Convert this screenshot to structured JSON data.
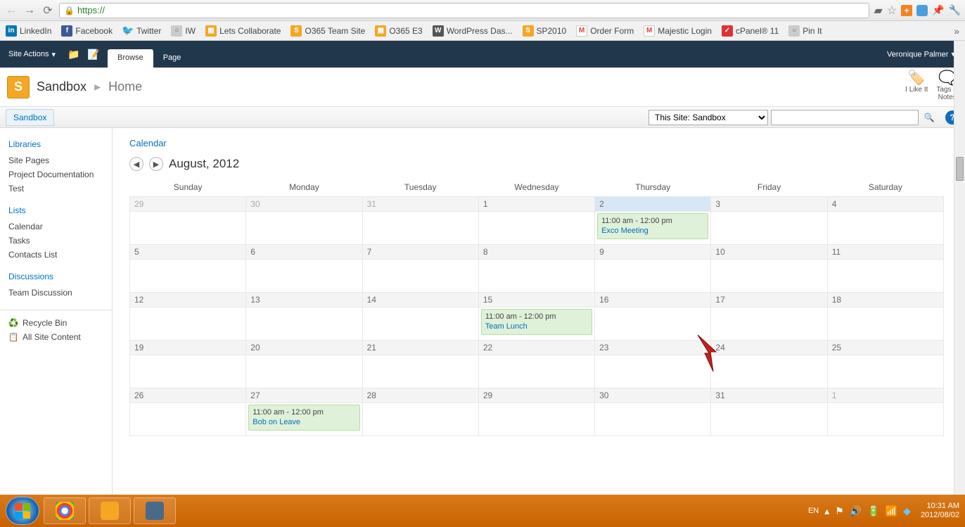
{
  "browser": {
    "url_scheme": "https://",
    "bookmarks": [
      {
        "label": "LinkedIn",
        "icon": "in"
      },
      {
        "label": "Facebook",
        "icon": "fb"
      },
      {
        "label": "Twitter",
        "icon": "tw"
      },
      {
        "label": "IW",
        "icon": "gray"
      },
      {
        "label": "Lets Collaborate",
        "icon": "or"
      },
      {
        "label": "O365 Team Site",
        "icon": "s"
      },
      {
        "label": "O365 E3",
        "icon": "or"
      },
      {
        "label": "WordPress Das...",
        "icon": "wp"
      },
      {
        "label": "SP2010",
        "icon": "s"
      },
      {
        "label": "Order Form",
        "icon": "g"
      },
      {
        "label": "Majestic Login",
        "icon": "g"
      },
      {
        "label": "cPanel® 11",
        "icon": "red"
      },
      {
        "label": "Pin It",
        "icon": "pin"
      }
    ]
  },
  "ribbon": {
    "site_actions": "Site Actions",
    "tabs": [
      {
        "label": "Browse",
        "active": true
      },
      {
        "label": "Page",
        "active": false
      }
    ],
    "user": "Veronique Palmer"
  },
  "title": {
    "site": "Sandbox",
    "page": "Home",
    "like_label": "I Like It",
    "tags_label": "Tags &\nNotes"
  },
  "topnav": {
    "tab": "Sandbox",
    "scope": "This Site: Sandbox"
  },
  "leftnav": {
    "groups": [
      {
        "heading": "Libraries",
        "items": [
          "Site Pages",
          "Project Documentation",
          "Test"
        ]
      },
      {
        "heading": "Lists",
        "items": [
          "Calendar",
          "Tasks",
          "Contacts List"
        ]
      },
      {
        "heading": "Discussions",
        "items": [
          "Team Discussion"
        ]
      }
    ],
    "util": [
      {
        "label": "Recycle Bin",
        "icon": "recycle"
      },
      {
        "label": "All Site Content",
        "icon": "allsite"
      }
    ]
  },
  "calendar": {
    "title": "Calendar",
    "month": "August, 2012",
    "days": [
      "Sunday",
      "Monday",
      "Tuesday",
      "Wednesday",
      "Thursday",
      "Friday",
      "Saturday"
    ],
    "weeks": [
      [
        {
          "n": "29",
          "other": true
        },
        {
          "n": "30",
          "other": true
        },
        {
          "n": "31",
          "other": true
        },
        {
          "n": "1"
        },
        {
          "n": "2",
          "today": true,
          "event": {
            "time": "11:00 am - 12:00 pm",
            "title": "Exco Meeting"
          }
        },
        {
          "n": "3"
        },
        {
          "n": "4"
        }
      ],
      [
        {
          "n": "5"
        },
        {
          "n": "6"
        },
        {
          "n": "7"
        },
        {
          "n": "8"
        },
        {
          "n": "9"
        },
        {
          "n": "10"
        },
        {
          "n": "11"
        }
      ],
      [
        {
          "n": "12"
        },
        {
          "n": "13"
        },
        {
          "n": "14"
        },
        {
          "n": "15",
          "event": {
            "time": "11:00 am - 12:00 pm",
            "title": "Team Lunch"
          }
        },
        {
          "n": "16"
        },
        {
          "n": "17"
        },
        {
          "n": "18"
        }
      ],
      [
        {
          "n": "19"
        },
        {
          "n": "20"
        },
        {
          "n": "21"
        },
        {
          "n": "22"
        },
        {
          "n": "23"
        },
        {
          "n": "24"
        },
        {
          "n": "25"
        }
      ],
      [
        {
          "n": "26"
        },
        {
          "n": "27",
          "event": {
            "time": "11:00 am - 12:00 pm",
            "title": "Bob on Leave"
          }
        },
        {
          "n": "28"
        },
        {
          "n": "29"
        },
        {
          "n": "30"
        },
        {
          "n": "31"
        },
        {
          "n": "1",
          "other": true
        }
      ]
    ]
  },
  "taskbar": {
    "lang": "EN",
    "time": "10:31 AM",
    "date": "2012/08/02"
  }
}
